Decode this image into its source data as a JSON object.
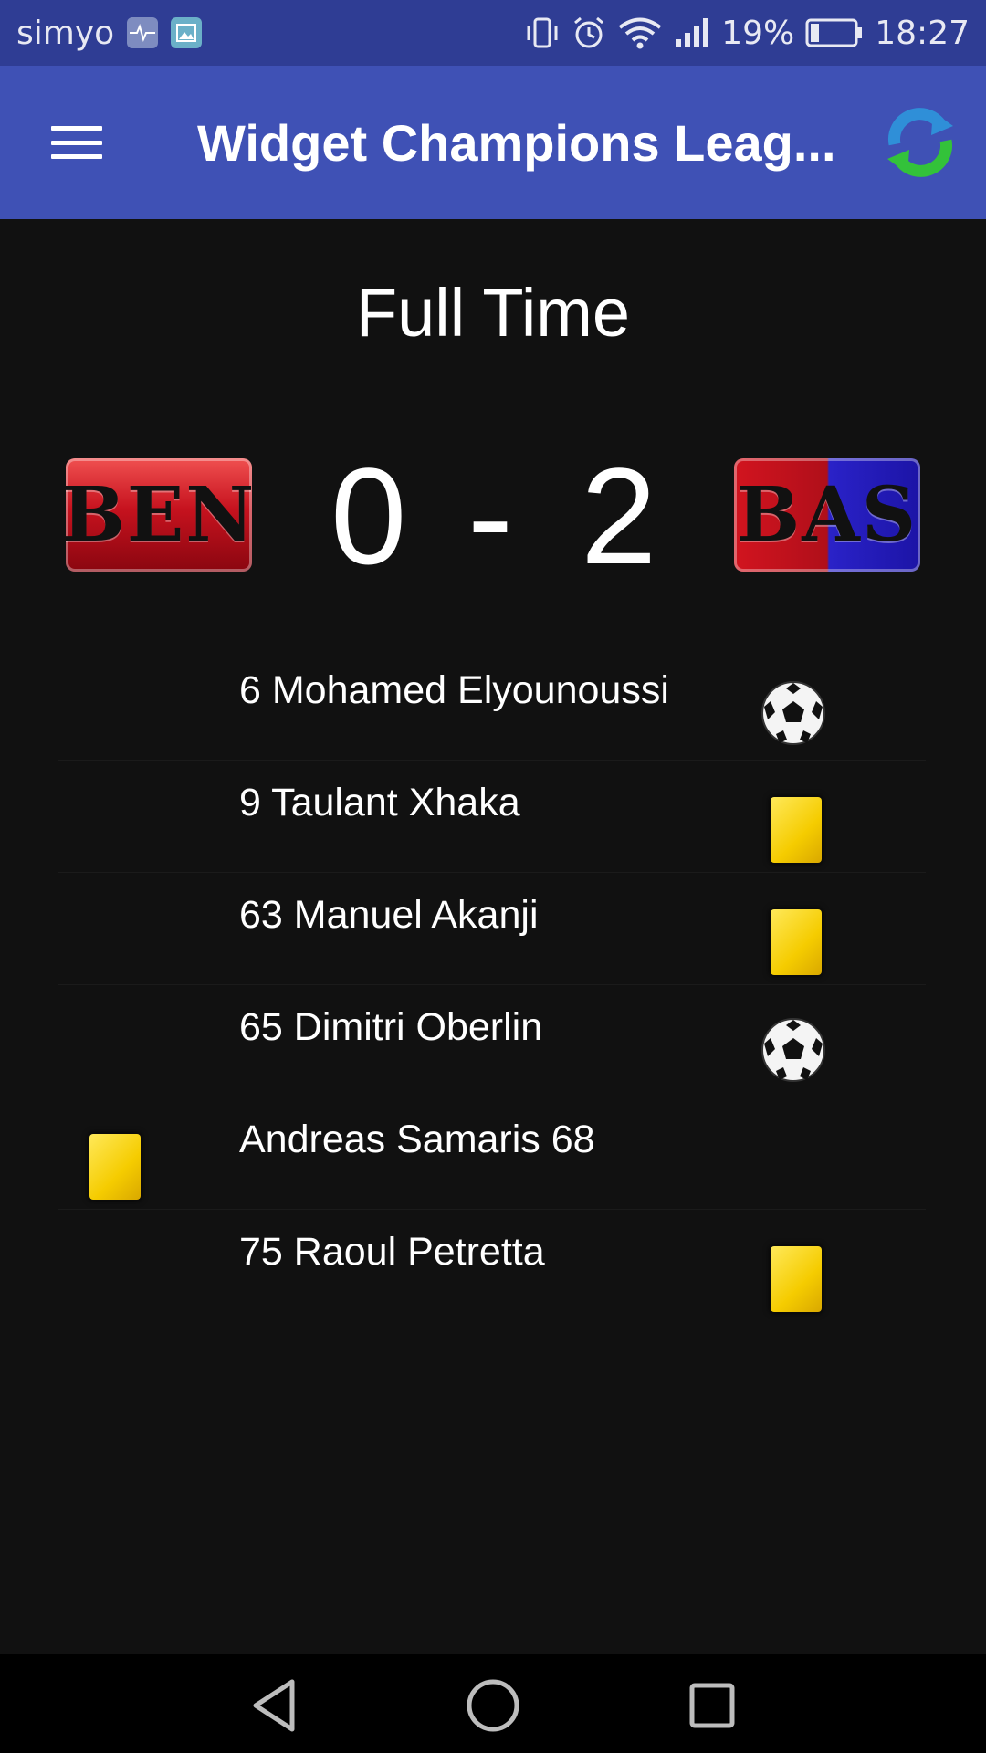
{
  "status_bar": {
    "carrier": "simyo",
    "battery": "19%",
    "time": "18:27"
  },
  "app_bar": {
    "title": "Widget Champions Leag..."
  },
  "match": {
    "status": "Full Time",
    "home_team": "BEN",
    "away_team": "BAS",
    "home_score": "0",
    "separator": "-",
    "away_score": "2"
  },
  "events": [
    {
      "text": "6 Mohamed Elyounoussi",
      "type": "goal-icon",
      "side": "away"
    },
    {
      "text": "9 Taulant Xhaka",
      "type": "yellow-card-icon",
      "side": "away"
    },
    {
      "text": "63 Manuel Akanji",
      "type": "yellow-card-icon",
      "side": "away"
    },
    {
      "text": "65 Dimitri Oberlin",
      "type": "goal-icon",
      "side": "away"
    },
    {
      "text": "Andreas Samaris 68",
      "type": "yellow-card-icon",
      "side": "home"
    },
    {
      "text": "75 Raoul Petretta",
      "type": "yellow-card-icon",
      "side": "away"
    }
  ],
  "colors": {
    "status_bar": "#2f3d94",
    "app_bar": "#3f51b5",
    "background": "#111111",
    "yellow_card": "#f5cc00"
  }
}
